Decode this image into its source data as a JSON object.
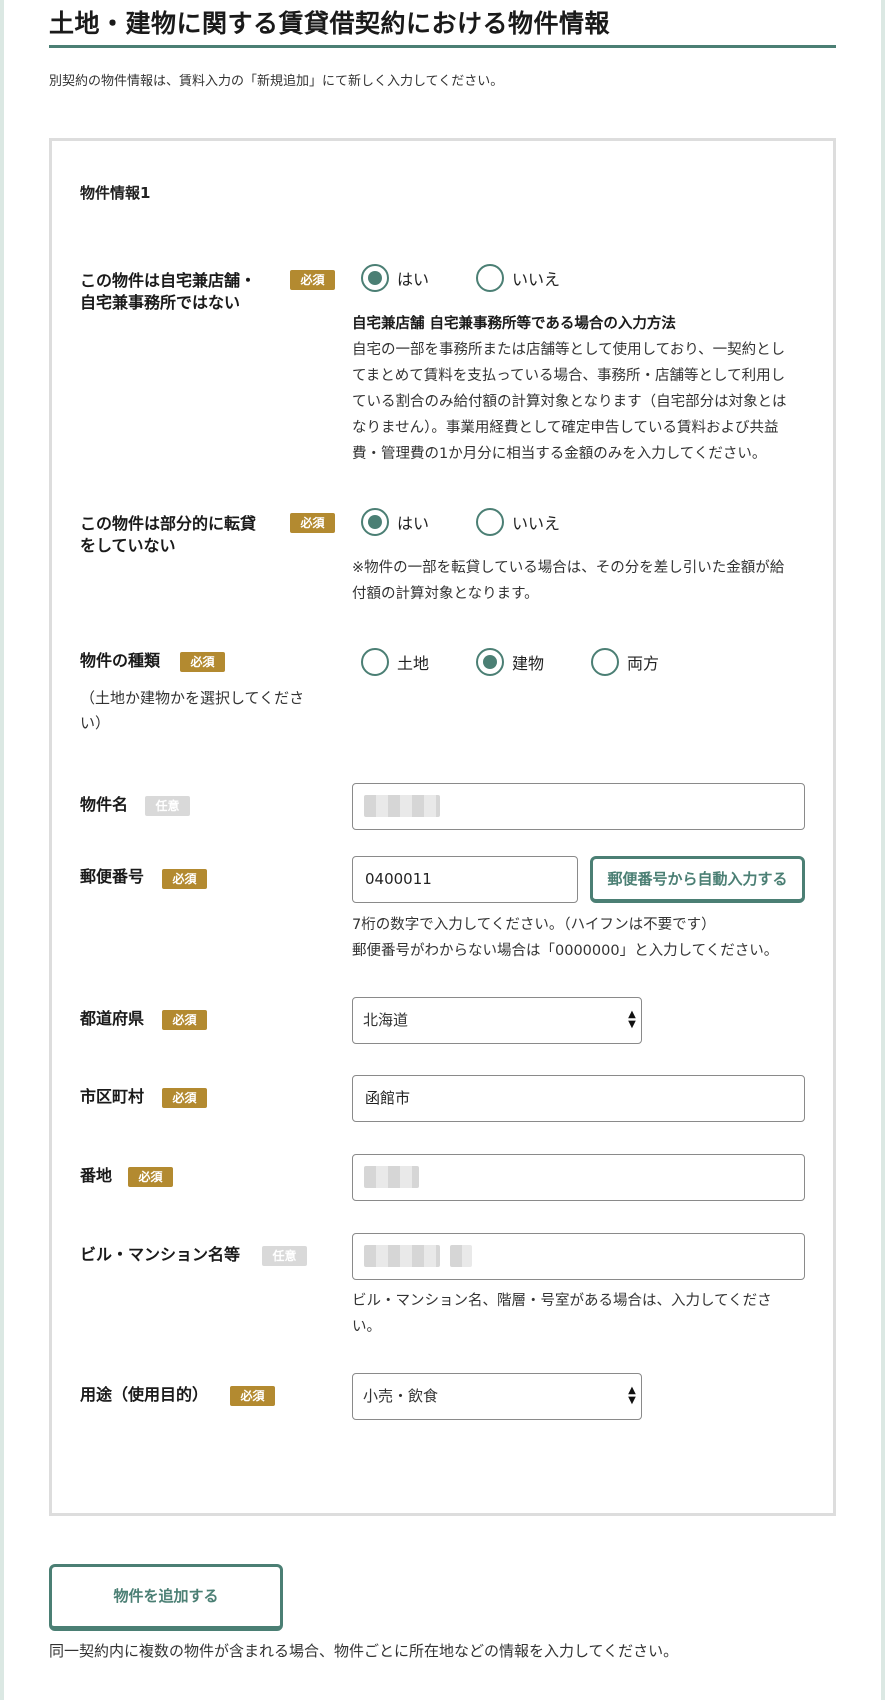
{
  "page": {
    "title": "土地・建物に関する賃貸借契約における物件情報",
    "intro": "別契約の物件情報は、賃料入力の「新規追加」にて新しく入力してください。"
  },
  "card": {
    "heading": "物件情報1"
  },
  "badges": {
    "required": "必須",
    "optional": "任意"
  },
  "q_home_office": {
    "label_line1": "この物件は自宅兼店舗・",
    "label_line2": "自宅兼事務所ではない",
    "options": [
      "はい",
      "いいえ"
    ],
    "selected": "はい",
    "help_title": "自宅兼店舗 自宅兼事務所等である場合の入力方法",
    "help_lines": [
      "自宅の一部を事務所または店舗等として使用しており、一契約とし",
      "てまとめて賃料を支払っている場合、事務所・店舗等として利用し",
      "ている割合のみ給付額の計算対象となります（自宅部分は対象とは",
      "なりません）。事業用経費として確定申告している賃料および共益",
      "費・管理費の1か月分に相当する金額のみを入力してください。"
    ]
  },
  "q_sublease": {
    "label_line1": "この物件は部分的に転貸",
    "label_line2": "をしていない",
    "options": [
      "はい",
      "いいえ"
    ],
    "selected": "はい",
    "help_lines": [
      "※物件の一部を転貸している場合は、その分を差し引いた金額が給",
      "付額の計算対象となります。"
    ]
  },
  "q_type": {
    "label": "物件の種類",
    "sub_line1": "（土地か建物かを選択してくださ",
    "sub_line2": "い）",
    "options": [
      "土地",
      "建物",
      "両方"
    ],
    "selected": "建物"
  },
  "property_name": {
    "label": "物件名",
    "value": ""
  },
  "postal": {
    "label": "郵便番号",
    "value": "0400011",
    "button": "郵便番号から自動入力する",
    "help_lines": [
      "7桁の数字で入力してください。（ハイフンは不要です）",
      "郵便番号がわからない場合は「0000000」と入力してください。"
    ]
  },
  "prefecture": {
    "label": "都道府県",
    "value": "北海道"
  },
  "city": {
    "label": "市区町村",
    "value": "函館市"
  },
  "address": {
    "label": "番地",
    "value": ""
  },
  "building": {
    "label": "ビル・マンション名等",
    "value": "",
    "help_lines": [
      "ビル・マンション名、階層・号室がある場合は、入力してくださ",
      "い。"
    ]
  },
  "usage": {
    "label": "用途（使用目的）",
    "value": "小売・飲食"
  },
  "add_button": "物件を追加する",
  "footer_note": "同一契約内に複数の物件が含まれる場合、物件ごとに所在地などの情報を入力してください。",
  "colors": {
    "accent": "#4b7f74",
    "required_badge": "#b38a30",
    "optional_badge": "#d9d9d9"
  }
}
